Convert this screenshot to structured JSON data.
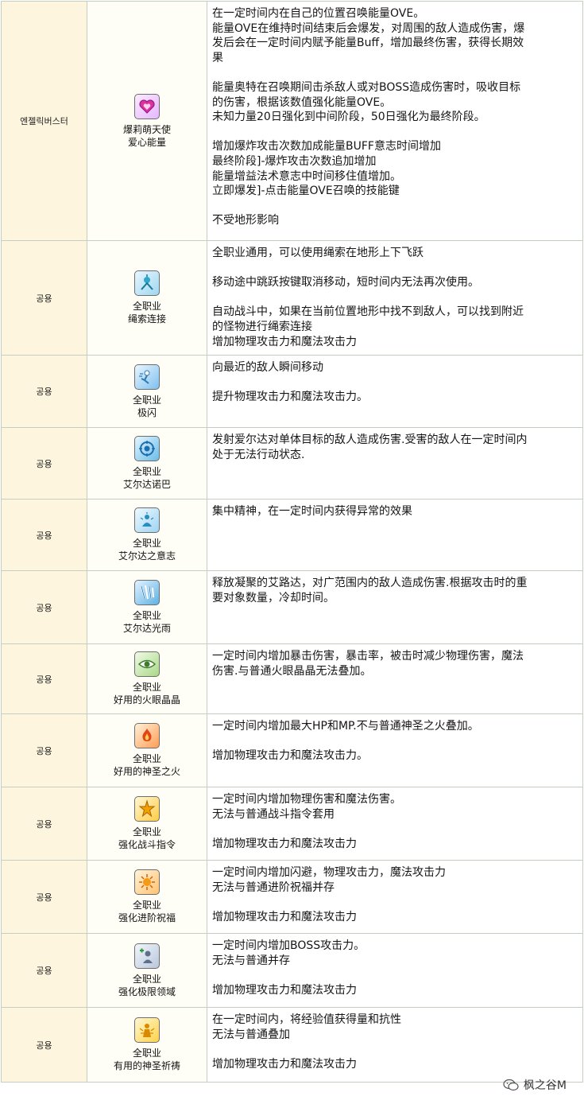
{
  "rows": [
    {
      "category": "엔젤릭버스터",
      "skill_lines": [
        "爆莉萌天使",
        "爱心能量"
      ],
      "icon": "heart-icon",
      "desc": [
        "在一定时间内在自己的位置召唤能量OVE。",
        "能量OVE在维持时间结束后会爆发，对周围的敌人造成伤害，爆",
        "发后会在一定时间内赋予能量Buff，增加最终伤害，获得长期效",
        "果",
        "",
        "能量奥特在召唤期间击杀敌人或对BOSS造成伤害时，吸收目标",
        "的伤害，根据该数值强化能量OVE。",
        "未知力量20日强化到中间阶段，50日强化为最终阶段。",
        "",
        "增加爆炸攻击次数加成能量BUFF意志时间增加",
        "最终阶段]-爆炸攻击次数追加增加",
        "能量增益法术意志中时间移住值增加。",
        "立即爆发]-点击能量OVE召唤的技能键",
        "",
        "不受地形影响"
      ]
    },
    {
      "category": "공용",
      "skill_lines": [
        "全职业",
        "绳索连接"
      ],
      "icon": "rope-connect-icon",
      "desc": [
        "全职业通用，可以使用绳索在地形上下飞跃",
        "",
        "移动途中跳跃按键取消移动，短时间内无法再次使用。",
        "",
        "自动战斗中，如果在当前位置地形中找不到敌人，可以找到附近",
        "的怪物进行绳索连接",
        "增加物理攻击力和魔法攻击力"
      ]
    },
    {
      "category": "공용",
      "skill_lines": [
        "全职业",
        "极闪"
      ],
      "icon": "flash-dash-icon",
      "desc": [
        "向最近的敌人瞬间移动",
        "",
        "提升物理攻击力和魔法攻击力。"
      ]
    },
    {
      "category": "공용",
      "skill_lines": [
        "全职业",
        "艾尔达诺巴"
      ],
      "icon": "erda-nova-icon",
      "desc": [
        "发射爱尔达对单体目标的敌人造成伤害.受害的敌人在一定时间内",
        "处于无法行动状态."
      ]
    },
    {
      "category": "공용",
      "skill_lines": [
        "全职业",
        "艾尔达之意志"
      ],
      "icon": "erda-will-icon",
      "desc": [
        "集中精神，在一定时间内获得异常的效果"
      ]
    },
    {
      "category": "공용",
      "skill_lines": [
        "全职业",
        "艾尔达光雨"
      ],
      "icon": "erda-shower-icon",
      "desc": [
        "释放凝聚的艾路达，对广范围内的敌人造成伤害.根据攻击时的重",
        "要对象数量，冷却时间。"
      ]
    },
    {
      "category": "공용",
      "skill_lines": [
        "全职业",
        "好用的火眼晶晶"
      ],
      "icon": "sharp-eyes-icon",
      "desc": [
        "一定时间内增加暴击伤害，暴击率，被击时减少物理伤害，魔法",
        "伤害.与普通火眼晶晶无法叠加。"
      ]
    },
    {
      "category": "공용",
      "skill_lines": [
        "全职业",
        "好用的神圣之火"
      ],
      "icon": "hyper-body-icon",
      "desc": [
        "一定时间内增加最大HP和MP.不与普通神圣之火叠加。",
        "",
        "增加物理攻击力和魔法攻击力。"
      ]
    },
    {
      "category": "공용",
      "skill_lines": [
        "全职业",
        "强化战斗指令"
      ],
      "icon": "combat-orders-icon",
      "desc": [
        "一定时间内增加物理伤害和魔法伤害。",
        "无法与普通战斗指令套用",
        "",
        "增加物理攻击力和魔法攻击力"
      ]
    },
    {
      "category": "공용",
      "skill_lines": [
        "全职业",
        "强化进阶祝福"
      ],
      "icon": "advanced-blessing-icon",
      "desc": [
        "一定时间内增加闪避，物理攻击力，魔法攻击力",
        "无法与普通进阶祝福并存",
        "",
        "增加物理攻击力和魔法攻击力"
      ]
    },
    {
      "category": "공용",
      "skill_lines": [
        "全职业",
        "强化极限领域"
      ],
      "icon": "boss-buff-icon",
      "desc": [
        "一定时间内增加BOSS攻击力。",
        "无法与普通并存",
        "",
        "增加物理攻击力和魔法攻击力"
      ]
    },
    {
      "category": "공용",
      "skill_lines": [
        "全职业",
        "有用的神圣祈祷"
      ],
      "icon": "holy-prayer-icon",
      "desc": [
        "在一定时间内，将经验值获得量和抗性",
        "无法与普通叠加",
        "",
        "增加物理攻击力和魔法攻击力"
      ]
    }
  ],
  "watermark": {
    "text": "枫之谷M",
    "icon": "wechat-icon"
  }
}
